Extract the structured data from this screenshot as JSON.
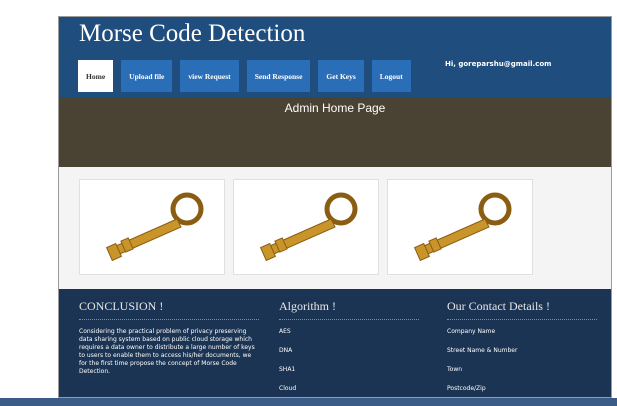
{
  "header": {
    "title": "Morse Code Detection",
    "user_greeting": "Hi, goreparshu@gmail.com"
  },
  "nav": [
    {
      "label": "Home",
      "active": true
    },
    {
      "label": "Upload file",
      "active": false
    },
    {
      "label": "view Request",
      "active": false
    },
    {
      "label": "Send Response",
      "active": false
    },
    {
      "label": "Get Keys",
      "active": false
    },
    {
      "label": "Logout",
      "active": false
    }
  ],
  "banner": {
    "title": "Admin Home Page"
  },
  "keys": {
    "icon": "golden-key-icon",
    "count": 3
  },
  "footer": {
    "conclusion": {
      "heading": "CONCLUSION !",
      "text": "Considering the practical problem of privacy preserving data sharing system based on public cloud storage which requires a data owner to distribute a large number of keys to users to enable them to access his/her documents, we for the first time propose the concept of Morse Code Detection."
    },
    "algorithm": {
      "heading": "Algorithm !",
      "items": [
        "AES",
        "DNA",
        "SHA1",
        "Cloud"
      ]
    },
    "contact": {
      "heading": "Our Contact Details !",
      "items": [
        "Company Name",
        "Street Name & Number",
        "Town",
        "Postcode/Zip"
      ]
    }
  },
  "colors": {
    "header_bg": "#1f4d7e",
    "nav_bg": "#2b6eb8",
    "banner_bg": "#4a4233",
    "footer_bg": "#1c3453",
    "key_gold": "#c9952a"
  }
}
